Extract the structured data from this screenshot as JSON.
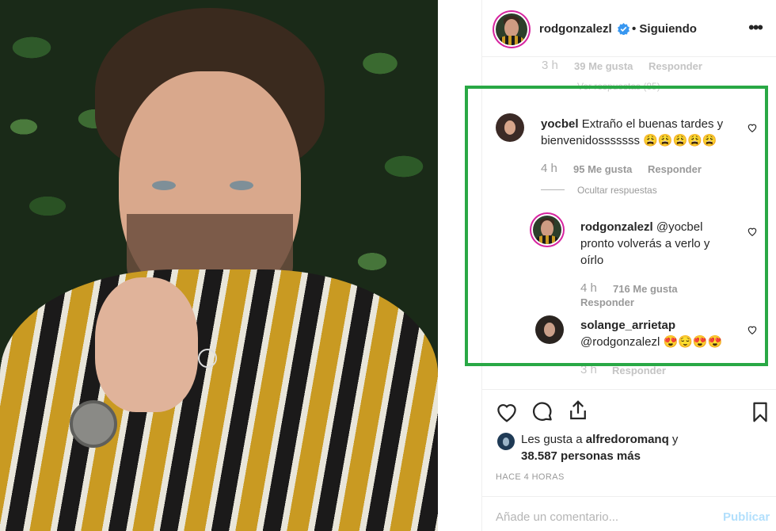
{
  "post": {
    "username": "rodgonzalezl",
    "following_label": "• Siguiendo",
    "more_label": "•••"
  },
  "comments": {
    "prev": {
      "time": "3 h",
      "likes": "39 Me gusta",
      "reply": "Responder",
      "view_replies": "Ver respuestas (85)"
    },
    "main": {
      "user": "yocbel",
      "text": "Extraño el buenas tardes y bienvenidosssssss 😩😩😩😩😩",
      "time": "4 h",
      "likes": "95 Me gusta",
      "reply": "Responder",
      "hide_replies": "Ocultar respuestas"
    },
    "reply1": {
      "user": "rodgonzalezl",
      "mention": "@yocbel",
      "text": "pronto volverás a verlo y oírlo",
      "time": "4 h",
      "likes": "716 Me gusta",
      "reply": "Responder"
    },
    "reply2": {
      "user": "solange_arrietap",
      "text": "@rodgonzalezl 😍😌😍😍",
      "time": "3 h",
      "reply": "Responder"
    }
  },
  "footer": {
    "likes_prefix": "Les gusta a ",
    "likes_user": "alfredoromanq",
    "likes_suffix": " y",
    "likes_count": "38.587 personas más",
    "time_ago": "HACE 4 HORAS",
    "comment_placeholder": "Añade un comentario...",
    "publish_label": "Publicar"
  },
  "colors": {
    "highlight": "#29a845",
    "verified": "#3897f0",
    "publish_disabled": "#b2dffc"
  },
  "icons": [
    "heart-icon",
    "comment-icon",
    "share-icon",
    "bookmark-icon",
    "verified-icon"
  ]
}
